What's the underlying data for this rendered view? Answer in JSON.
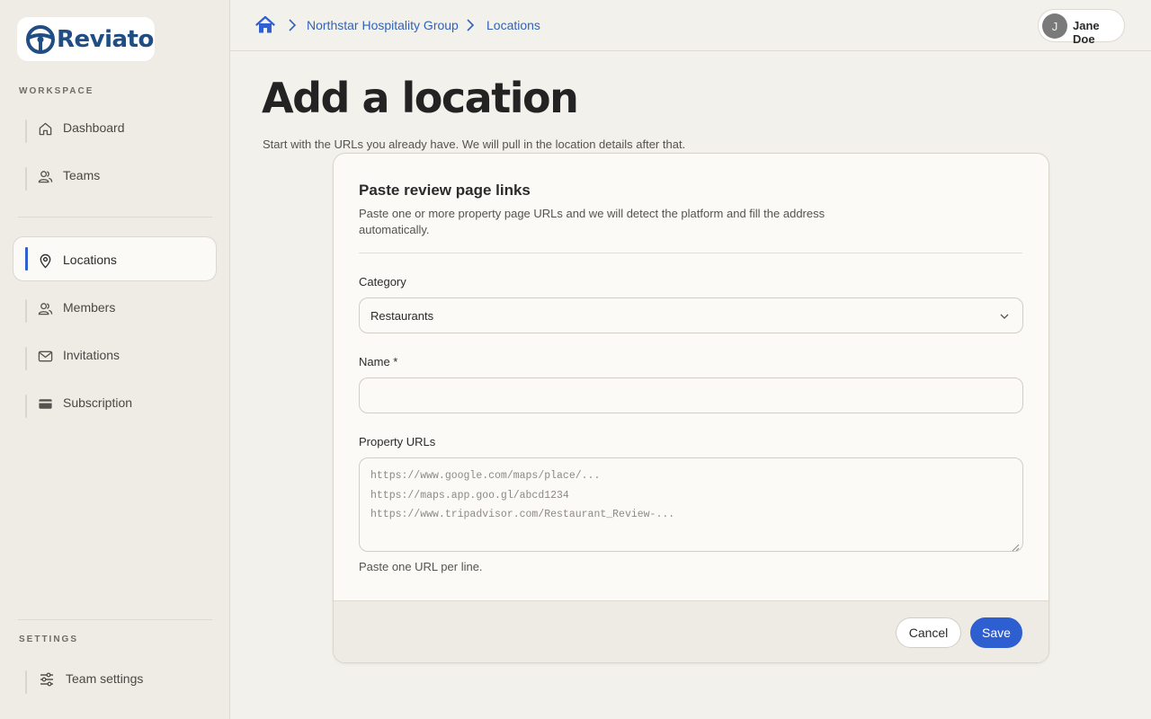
{
  "brand": {
    "name": "Reviato",
    "color": "#1f4d84"
  },
  "sidebar": {
    "workspace_label": "WORKSPACE",
    "settings_label": "SETTINGS",
    "items": [
      {
        "label": "Dashboard",
        "icon": "home-icon"
      },
      {
        "label": "Teams",
        "icon": "users-icon"
      },
      {
        "label": "Locations",
        "icon": "map-pin-icon",
        "active": true
      },
      {
        "label": "Members",
        "icon": "users-icon"
      },
      {
        "label": "Invitations",
        "icon": "mail-icon"
      },
      {
        "label": "Subscription",
        "icon": "credit-card-icon"
      }
    ],
    "settings_items": [
      {
        "label": "Team settings",
        "icon": "sliders-icon"
      }
    ]
  },
  "header": {
    "breadcrumb": [
      "Northstar Hospitality Group",
      "Locations"
    ],
    "user": {
      "initial": "J",
      "name": "Jane Doe"
    }
  },
  "main": {
    "title": "Add a location",
    "subtitle": "Start with the URLs you already have. We will pull in the location details after that."
  },
  "form": {
    "title": "Paste review page links",
    "description": "Paste one or more property page URLs and we will detect the platform and fill the address automatically.",
    "category_label": "Category",
    "category_value": "Restaurants",
    "name_label": "Name *",
    "name_value": "",
    "urls_label": "Property URLs",
    "urls_placeholder": [
      "https://www.google.com/maps/place/...",
      "https://maps.app.goo.gl/abcd1234",
      "https://www.tripadvisor.com/Restaurant_Review-..."
    ],
    "urls_hint": "Paste one URL per line.",
    "cancel_label": "Cancel",
    "save_label": "Save"
  },
  "colors": {
    "accent": "#2e5fd0",
    "link": "#3363b7",
    "background": "#f3f1ec"
  }
}
